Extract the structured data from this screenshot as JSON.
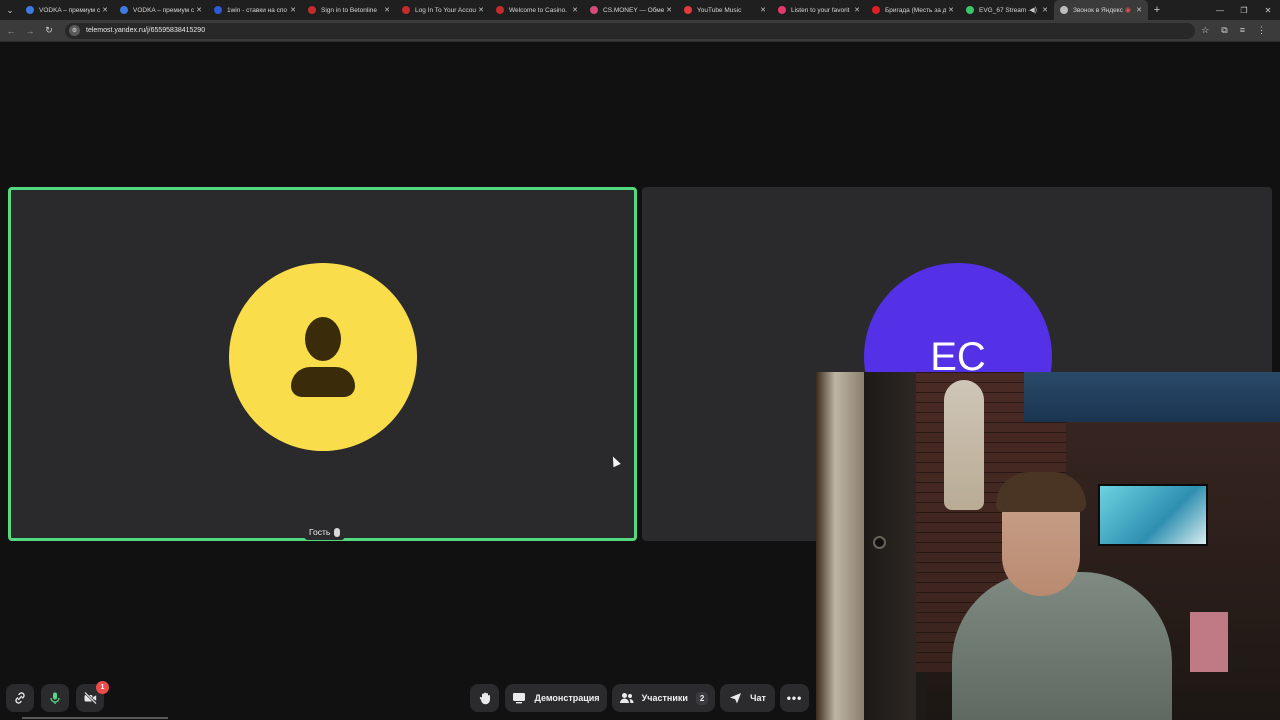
{
  "browser": {
    "tabs": [
      {
        "title": "VODKA – премиум ca",
        "favicon_color": "#3d7be0",
        "active": false
      },
      {
        "title": "VODKA – премиум ca",
        "favicon_color": "#3d7be0",
        "active": false
      },
      {
        "title": "1win - ставки на спо",
        "favicon_color": "#2b5bd6",
        "active": false
      },
      {
        "title": "Sign in to Betonline",
        "favicon_color": "#c42b2b",
        "active": false
      },
      {
        "title": "Log In To Your Accou",
        "favicon_color": "#c42b2b",
        "active": false
      },
      {
        "title": "Welcome to Casino.",
        "favicon_color": "#c42b2b",
        "active": false
      },
      {
        "title": "CS.MONEY — Обмен",
        "favicon_color": "#d64a7a",
        "active": false
      },
      {
        "title": "YouTube Music",
        "favicon_color": "#e23b3b",
        "active": false
      },
      {
        "title": "Listen to your favorit",
        "favicon_color": "#e23b6b",
        "active": false
      },
      {
        "title": "Бригада (Месть за д",
        "favicon_color": "#e02020",
        "active": false
      },
      {
        "title": "EVG_67 Stream - ",
        "favicon_color": "#39c66b",
        "active": false
      },
      {
        "title": "Звонок в Яндекс",
        "favicon_color": "#bdbdbd",
        "active": true
      }
    ],
    "url": "telemost.yandex.ru/j/65595838415290"
  },
  "meeting": {
    "participants": [
      {
        "name": "Гость",
        "avatar_color": "#f9dd4a",
        "speaking": true
      },
      {
        "initials": "ЕС",
        "avatar_color": "#5431e6",
        "speaking": false
      }
    ]
  },
  "controls": {
    "camera_badge": "1",
    "demo_label": "Демонстрация",
    "participants_label": "Участники",
    "participants_count": "2",
    "chat_label": "Чат"
  },
  "colors": {
    "speaking_border": "#54d882",
    "tile_bg": "#2a2a2d",
    "page_bg": "#111112",
    "mic_active": "#54d882",
    "badge": "#f04b4b"
  }
}
